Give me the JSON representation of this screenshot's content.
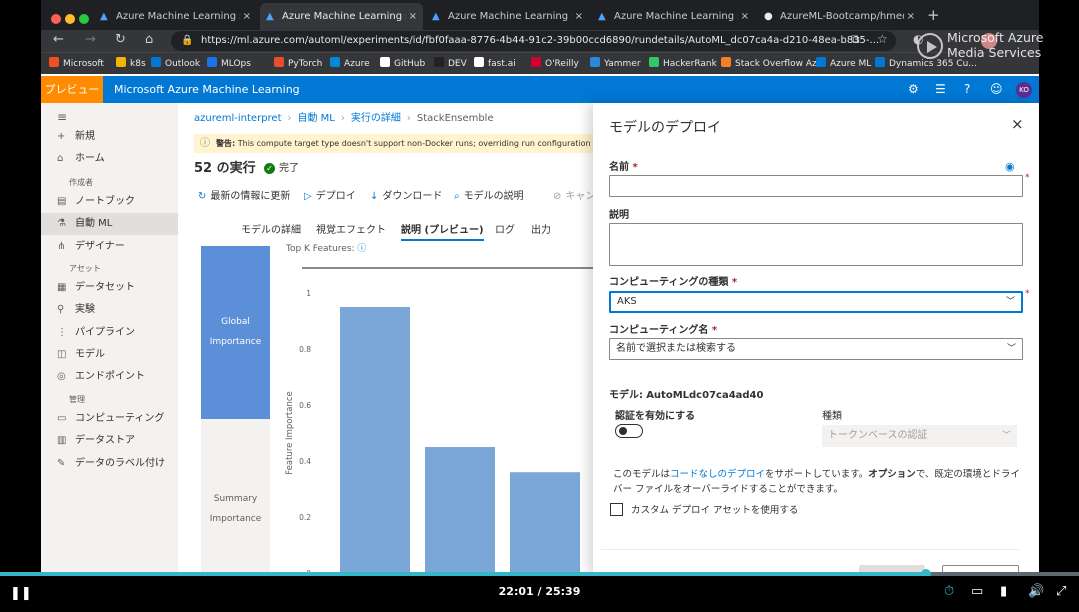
{
  "browser": {
    "tabs": [
      {
        "label": "Azure Machine Learning studi",
        "icon": "azure-icon",
        "active": false
      },
      {
        "label": "Azure Machine Learning studi",
        "icon": "azure-icon",
        "active": true
      },
      {
        "label": "Azure Machine Learning studi",
        "icon": "azure-icon",
        "active": false
      },
      {
        "label": "Azure Machine Learning studi",
        "icon": "azure-icon",
        "active": false
      },
      {
        "label": "AzureML-Bootcamp/hmeq-cla",
        "icon": "github-icon",
        "active": false
      }
    ],
    "new_tab": "+",
    "tab_close": "×",
    "url": "https://ml.azure.com/automl/experiments/id/fbf0faaa-8776-4b44-91c2-39b00ccd6890/rundetails/AutoML_dc07ca4a-d210-48ea-b835-...",
    "bookmarks": [
      "Microsoft",
      "k8s",
      "Outlook",
      "MLOps",
      "PyTorch",
      "Azure",
      "GitHub",
      "DEV",
      "fast.ai",
      "O'Reilly",
      "Yammer",
      "HackerRank",
      "Stack Overflow Az...",
      "Azure ML",
      "Dynamics 365 Cu..."
    ]
  },
  "watermark": {
    "line1": "Microsoft Azure",
    "line2": "Media Services"
  },
  "azure_header": {
    "preview_badge": "プレビュー",
    "title": "Microsoft Azure Machine Learning",
    "user_initials": "KO"
  },
  "sidebar": {
    "items_top": [
      {
        "label": "新規",
        "icon": "plus-icon"
      },
      {
        "label": "ホーム",
        "icon": "home-icon"
      }
    ],
    "section_author": "作成者",
    "items_author": [
      {
        "label": "ノートブック",
        "icon": "notebook-icon"
      },
      {
        "label": "自動 ML",
        "icon": "automl-icon",
        "active": true
      },
      {
        "label": "デザイナー",
        "icon": "designer-icon"
      }
    ],
    "section_assets": "アセット",
    "items_assets": [
      {
        "label": "データセット",
        "icon": "dataset-icon"
      },
      {
        "label": "実験",
        "icon": "experiment-icon"
      },
      {
        "label": "パイプライン",
        "icon": "pipeline-icon"
      },
      {
        "label": "モデル",
        "icon": "model-icon"
      },
      {
        "label": "エンドポイント",
        "icon": "endpoint-icon"
      }
    ],
    "section_manage": "管理",
    "items_manage": [
      {
        "label": "コンピューティング",
        "icon": "compute-icon"
      },
      {
        "label": "データストア",
        "icon": "datastore-icon"
      },
      {
        "label": "データのラベル付け",
        "icon": "labeling-icon"
      }
    ]
  },
  "main": {
    "breadcrumb": [
      "azureml-interpret",
      "自動 ML",
      "実行の詳細",
      "StackEnsemble"
    ],
    "warning_label": "警告:",
    "warning_text": "This compute target type doesn't support non-Docker runs; overriding run configuration to enat",
    "run_title": "52 の実行",
    "run_status": "完了",
    "commands": [
      "最新の情報に更新",
      "デプロイ",
      "ダウンロード",
      "モデルの説明",
      "キャン"
    ],
    "tabs": [
      "モデルの詳細",
      "視覚エフェクト",
      "説明 (プレビュー)",
      "ログ",
      "出力"
    ],
    "active_tab": 2,
    "global_importance": [
      "Global",
      "Importance"
    ],
    "summary_importance": [
      "Summary",
      "Importance"
    ],
    "topk_label": "Top K Features:"
  },
  "chart_data": {
    "type": "bar",
    "ylabel": "Feature Importance",
    "ylim": [
      0,
      1
    ],
    "yticks": [
      "1",
      "0.8",
      "0.6",
      "0.4",
      "0.2",
      "0"
    ],
    "values": [
      0.95,
      0.45,
      0.36
    ],
    "color": "#7aa6d8"
  },
  "panel": {
    "title": "モデルのデプロイ",
    "name_label": "名前",
    "name_value": "",
    "desc_label": "説明",
    "compute_type_label": "コンピューティングの種類",
    "compute_type_value": "AKS",
    "compute_name_label": "コンピューティング名",
    "compute_name_placeholder": "名前で選択または検索する",
    "model_prefix": "モデル:",
    "model_value": "AutoMLdc07ca4ad40",
    "auth_label": "認証を有効にする",
    "auth_enabled": false,
    "type_label": "種類",
    "type_value": "トークンベースの認証",
    "nocode_1": "このモデルは",
    "nocode_link": "コードなしのデプロイ",
    "nocode_2": "をサポートしています。",
    "nocode_bold": "オプション",
    "nocode_3": "で、既定の環境とドライバー ファイルをオーバーライドすることができます。",
    "custom_label": "カスタム デプロイ アセットを使用する",
    "required_mark": "*",
    "close": "×"
  },
  "player": {
    "time": "22:01 / 25:39",
    "progress": 0.858,
    "pause": "❚❚"
  },
  "colors": {
    "azure_blue": "#0078d4",
    "preview_orange": "#ff8c00",
    "player_accent": "#36b7c9"
  }
}
